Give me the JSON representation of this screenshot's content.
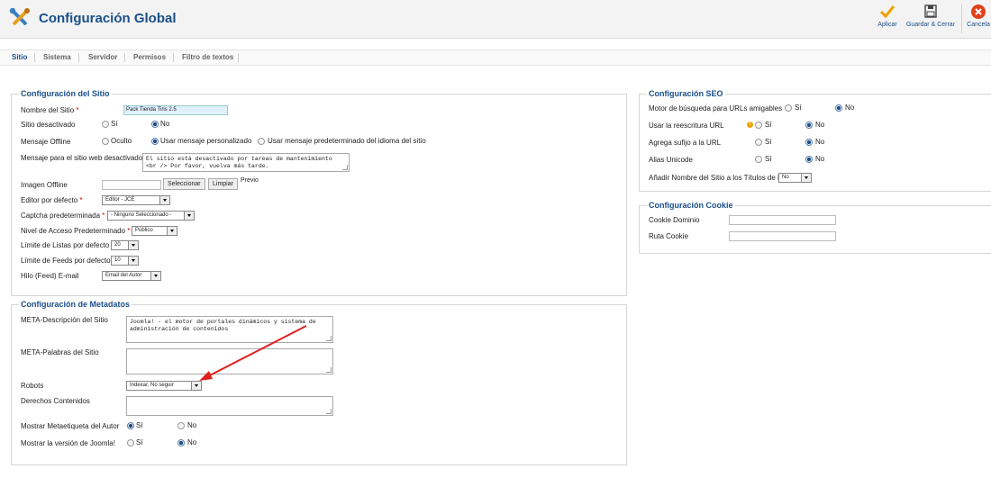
{
  "header": {
    "title": "Configuración Global",
    "apply_label": "Aplicar",
    "save_close_label": "Guardar & Cerrar",
    "cancel_label": "Cancela"
  },
  "tabs": [
    "Sitio",
    "Sistema",
    "Servidor",
    "Permisos",
    "Filtro de textos"
  ],
  "site": {
    "legend": "Configuración del Sitio",
    "site_name_label": "Nombre del Sitio",
    "site_name_value": "Pack Tienda Tiris 2.5",
    "site_offline_label": "Sitio desactivado",
    "site_offline_yes": "Sí",
    "site_offline_no": "No",
    "offline_message_label": "Mensaje Offline",
    "offline_msg_hidden": "Oculto",
    "offline_msg_custom": "Usar mensaje personalizado",
    "offline_msg_default": "Usar mensaje predeterminado del idioma del sitio",
    "offline_text_label": "Mensaje para el sitio web desactivado",
    "offline_text_value": "El sitio está desactivado por tareas de mantenimiento <br /> Por favor, vuelva más tarde.",
    "offline_image_label": "Imagen Offline",
    "select_button": "Seleccionar",
    "clear_button": "Limpiar",
    "preview_label": "Previo",
    "editor_label": "Editor por defecto",
    "editor_value": "Editor - JCE",
    "captcha_label": "Captcha predeterminada",
    "captcha_value": "- Ninguno Seleccionado -",
    "access_label": "Nivel de Acceso Predeterminado",
    "access_value": "Público",
    "list_limit_label": "Límite de Listas por defecto",
    "list_limit_value": "20",
    "feed_limit_label": "Límite de Feeds por defecto",
    "feed_limit_value": "10",
    "feed_email_label": "Hilo (Feed) E-mail",
    "feed_email_value": "Email del Autor"
  },
  "metadata": {
    "legend": "Configuración de Metadatos",
    "description_label": "META-Descripción del Sitio",
    "description_value": "Joomla! - el motor de portales dinámicos y sistema de administración de contenidos",
    "keywords_label": "META-Palabras del Sitio",
    "keywords_value": "",
    "robots_label": "Robots",
    "robots_value": "Indexar, No seguir",
    "rights_label": "Derechos Contenidos",
    "rights_value": "",
    "author_meta_label": "Mostrar Metaetiqueta del Autor",
    "author_meta_yes": "Sí",
    "author_meta_no": "No",
    "version_label": "Mostrar la versión de Joomla!",
    "version_yes": "Sí",
    "version_no": "No"
  },
  "seo": {
    "legend": "Configuración SEO",
    "sef_label": "Motor de búsqueda para URLs amigables",
    "sef_yes": "Sí",
    "sef_no": "No",
    "rewrite_label": "Usar la reescritura URL",
    "rewrite_yes": "Sí",
    "rewrite_no": "No",
    "suffix_label": "Agrega sufijo a la URL",
    "suffix_yes": "Sí",
    "suffix_no": "No",
    "unicode_label": "Alias Unicode",
    "unicode_yes": "Sí",
    "unicode_no": "No",
    "sitename_label": "Añadir Nombre del Sitio a los Títulos de Páginas",
    "sitename_value": "No"
  },
  "cookie": {
    "legend": "Configuración Cookie",
    "domain_label": "Cookie Dominio",
    "domain_value": "",
    "path_label": "Ruta Cookie",
    "path_value": ""
  },
  "colors": {
    "accent": "#1a4f8a",
    "arrow": "#e02020",
    "apply": "#f0a000",
    "cancel": "#e0401a"
  },
  "icons": [
    "tools-icon",
    "checkmark-icon",
    "save-icon",
    "cancel-icon",
    "warning-icon"
  ]
}
